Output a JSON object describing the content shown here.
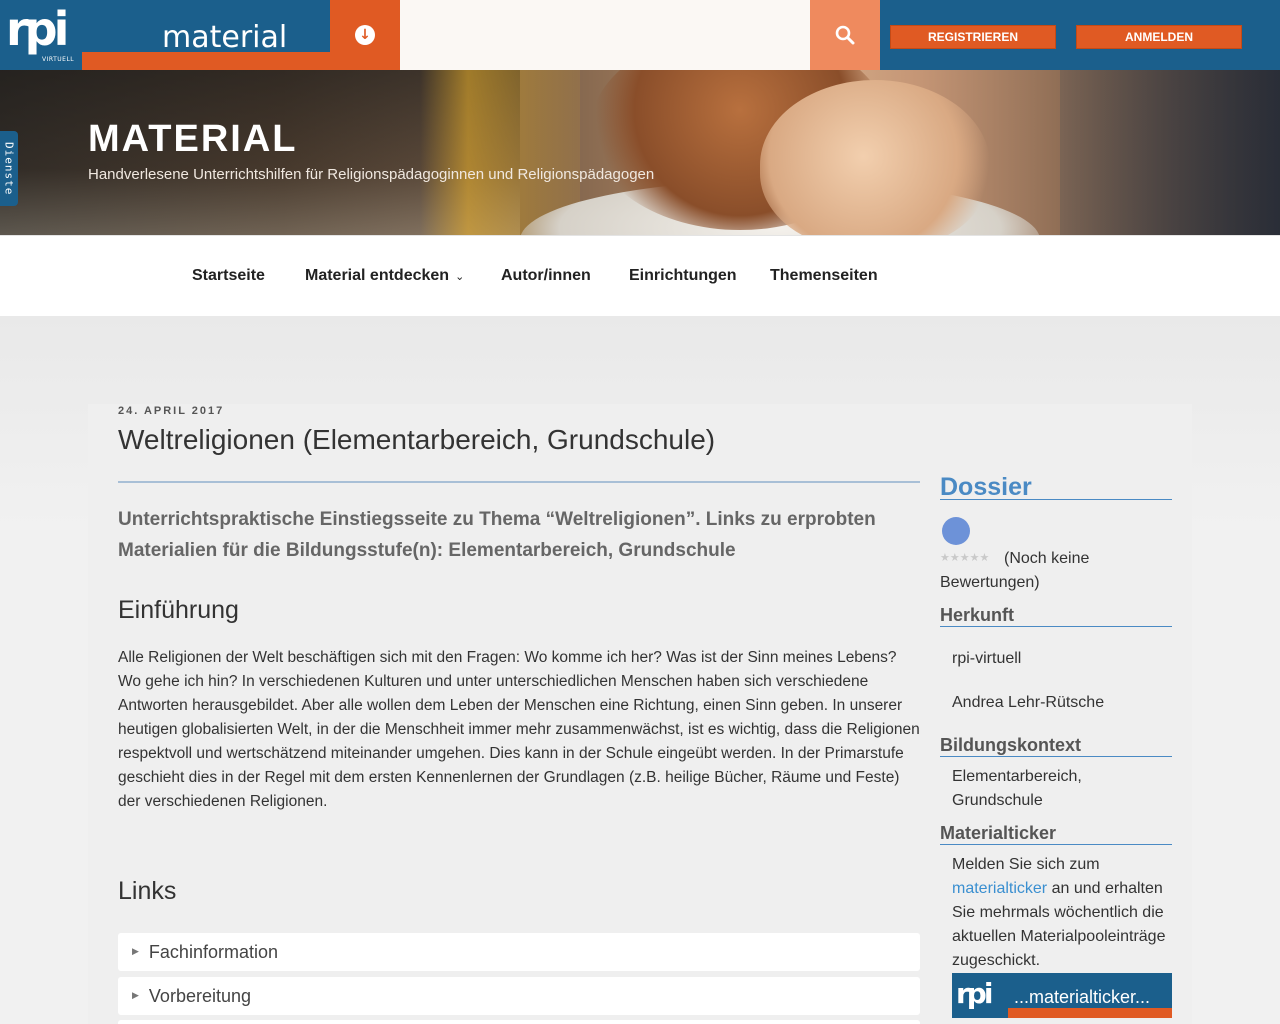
{
  "header": {
    "logo_text": "rpi",
    "logo_sub": "VIRTUELL",
    "site_name": "material",
    "search": {
      "value": "",
      "placeholder": ""
    },
    "register_label": "REGISTRIEREN",
    "login_label": "ANMELDEN",
    "colors": {
      "brand_blue": "#1b5f8c",
      "accent_orange": "#e05a23",
      "search_orange": "#ef8a5e"
    }
  },
  "hero": {
    "title": "MATERIAL",
    "subtitle": "Handverlesene Unterrichtshilfen für Religionspädagoginnen und Religionspädagogen"
  },
  "dienste_label": "Dienste",
  "nav": {
    "items": [
      {
        "label": "Startseite"
      },
      {
        "label": "Material entdecken"
      },
      {
        "label": "Autor/innen"
      },
      {
        "label": "Einrichtungen"
      },
      {
        "label": "Themenseiten"
      }
    ]
  },
  "post": {
    "date": "24. APRIL 2017",
    "title": "Weltreligionen (Elementarbereich, Grundschule)",
    "lead": "Unterrichtspraktische Einstiegsseite zu Thema “Weltreligionen”. Links zu erprobten Materialien für die Bildungsstufe(n): Elementarbereich, Grundschule",
    "intro_heading": "Einführung",
    "intro_text": "Alle Religionen der Welt beschäftigen sich mit den Fragen: Wo komme ich her? Was ist der Sinn meines Lebens? Wo gehe ich hin? In verschiedenen Kulturen und unter unterschiedlichen Menschen haben sich verschiedene Antworten herausgebildet. Aber alle wollen dem Leben der Menschen eine Richtung, einen Sinn geben. In unserer heutigen globalisierten Welt, in der die Menschheit immer mehr zusammenwächst, ist es wichtig, dass die Religionen respektvoll und wertschätzend miteinander umgehen. Dies kann in der Schule eingeübt werden. In der Primarstufe geschieht dies in der Regel mit dem ersten Kennenlernen der Grundlagen (z.B. heilige Bücher, Räume und Feste) der verschiedenen Religionen.",
    "links_heading": "Links",
    "accordion": [
      {
        "label": "Fachinformation"
      },
      {
        "label": "Vorbereitung"
      }
    ]
  },
  "sidebar": {
    "title": "Dossier",
    "rating_text": "(Noch keine Bewertungen)",
    "herkunft_heading": "Herkunft",
    "herkunft_source": "rpi-virtuell",
    "herkunft_author": "Andrea Lehr-Rütsche",
    "bildung_heading": "Bildungskontext",
    "bildung_value": "Elementarbereich, Grundschule",
    "ticker_heading": "Materialticker",
    "ticker_text_before": "Melden Sie sich zum",
    "ticker_link": "materialticker",
    "ticker_text_after": "an und erhalten Sie mehrmals wöchentlich die aktuellen Materialpooleinträge zugeschickt.",
    "ticker_banner_logo": "rpi",
    "ticker_banner_text": "...materialticker..."
  }
}
